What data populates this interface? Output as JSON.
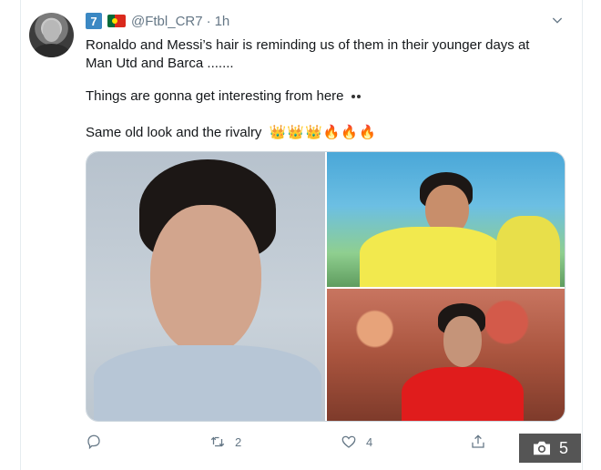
{
  "tweet": {
    "badge_number": "7",
    "handle": "@Ftbl_CR7",
    "separator": "·",
    "time": "1h",
    "text_line1": "Ronaldo and Messi’s hair is reminding us of them in their younger days at",
    "text_line2": "Man Utd and Barca .......",
    "text_line3": "Things are gonna get interesting from here",
    "text_line4": "Same old look and the rivalry",
    "line4_emojis": [
      "👑",
      "👑",
      "👑",
      "🔥",
      "🔥",
      "🔥"
    ]
  },
  "actions": {
    "reply_count": "",
    "retweet_count": "2",
    "like_count": "4"
  },
  "overlay": {
    "photo_count": "5"
  },
  "icons": [
    "avatar",
    "number-badge-icon",
    "portugal-flag-icon",
    "chevron-down-icon",
    "reply-icon",
    "retweet-icon",
    "like-icon",
    "share-icon",
    "camera-icon"
  ],
  "colors": {
    "text": "#14171a",
    "muted": "#657786",
    "border": "#e6ecf0",
    "overlay": "#555555"
  }
}
